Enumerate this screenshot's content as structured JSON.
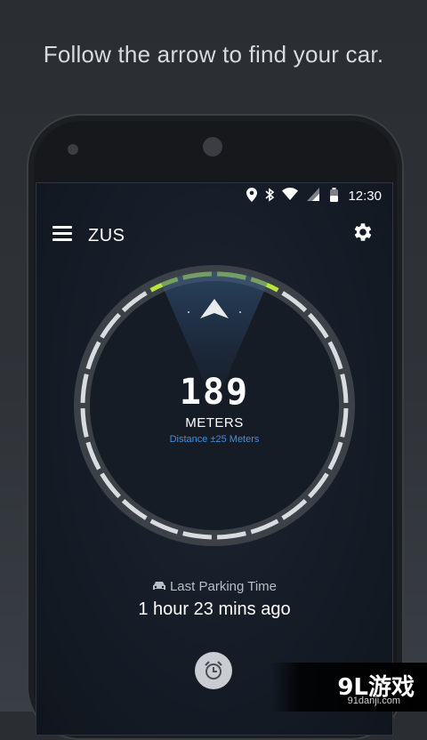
{
  "headline": "Follow the arrow to find your car.",
  "status": {
    "time": "12:30",
    "icons": [
      "location-icon",
      "bluetooth-icon",
      "wifi-icon",
      "signal-icon",
      "battery-icon"
    ]
  },
  "appbar": {
    "title": "ZUS",
    "menu_icon": "menu-icon",
    "settings_icon": "gear-icon"
  },
  "distance": {
    "value": "189",
    "unit": "METERS",
    "accuracy": "Distance ±25 Meters"
  },
  "parking": {
    "label": "Last Parking Time",
    "value": "1 hour 23 mins ago",
    "icon": "car-icon"
  },
  "alarm": {
    "icon": "alarm-clock-icon"
  },
  "watermark": {
    "logo": "9L游戏",
    "url": "91danji.com"
  },
  "colors": {
    "accent_green": "#b6e63b",
    "accent_blue": "#3d8fe0",
    "ring": "#d9dcdf"
  }
}
